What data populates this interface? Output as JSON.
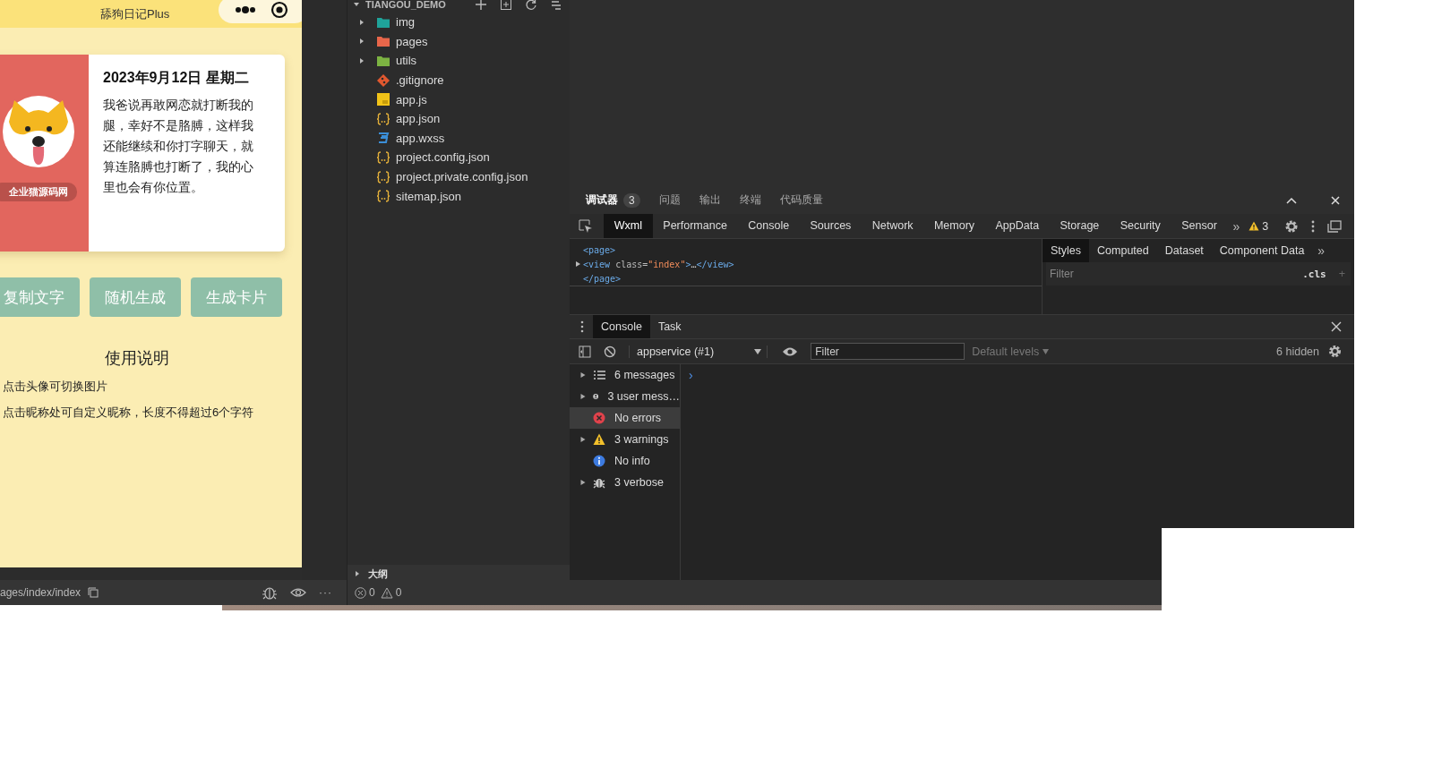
{
  "simulator": {
    "title": "舔狗日记Plus",
    "card": {
      "nickname": "企业猫源码网",
      "date": "2023年9月12日 星期二",
      "text": "我爸说再敢网恋就打断我的腿，幸好不是胳膊，这样我还能继续和你打字聊天，就算连胳膊也打断了，我的心里也会有你位置。"
    },
    "buttons": [
      "复制文字",
      "随机生成",
      "生成卡片"
    ],
    "help": {
      "title": "使用说明",
      "items": [
        "点击头像可切换图片",
        "点击昵称处可自定义昵称，长度不得超过6个字符"
      ]
    }
  },
  "explorer": {
    "title": "TIANGOU_DEMO",
    "files": [
      {
        "name": "img",
        "kind": "folder",
        "color": "#1fa39a",
        "expanded": false
      },
      {
        "name": "pages",
        "kind": "folder",
        "color": "#e8664a",
        "expanded": false
      },
      {
        "name": "utils",
        "kind": "folder",
        "color": "#7cb342",
        "expanded": false
      },
      {
        "name": ".gitignore",
        "kind": "git"
      },
      {
        "name": "app.js",
        "kind": "js"
      },
      {
        "name": "app.json",
        "kind": "json"
      },
      {
        "name": "app.wxss",
        "kind": "css"
      },
      {
        "name": "project.config.json",
        "kind": "json"
      },
      {
        "name": "project.private.config.json",
        "kind": "json"
      },
      {
        "name": "sitemap.json",
        "kind": "json"
      }
    ],
    "outline": {
      "label": "大纲",
      "expanded": false
    }
  },
  "devtools": {
    "tabs": [
      {
        "label": "调试器",
        "badge": "3",
        "selected": true
      },
      {
        "label": "问题",
        "selected": false
      },
      {
        "label": "输出",
        "selected": false
      },
      {
        "label": "终端",
        "selected": false
      },
      {
        "label": "代码质量",
        "selected": false
      }
    ],
    "panels": [
      {
        "label": "Wxml",
        "selected": true
      },
      {
        "label": "Performance",
        "selected": false
      },
      {
        "label": "Console",
        "selected": false
      },
      {
        "label": "Sources",
        "selected": false
      },
      {
        "label": "Network",
        "selected": false
      },
      {
        "label": "Memory",
        "selected": false
      },
      {
        "label": "AppData",
        "selected": false
      },
      {
        "label": "Storage",
        "selected": false
      },
      {
        "label": "Security",
        "selected": false
      },
      {
        "label": "Sensor",
        "selected": false
      }
    ],
    "more": "»",
    "warnings": "3",
    "wxml": [
      {
        "expandable": false,
        "parts": [
          {
            "kind": "tag",
            "text": "<page>"
          }
        ]
      },
      {
        "expandable": true,
        "parts": [
          {
            "kind": "tag",
            "text": "<view"
          },
          {
            "kind": "attr",
            "text": " class="
          },
          {
            "kind": "value",
            "text": "\"index\""
          },
          {
            "kind": "tag",
            "text": ">"
          },
          {
            "kind": "plain",
            "text": "…"
          },
          {
            "kind": "tag",
            "text": "</view>"
          }
        ]
      },
      {
        "expandable": false,
        "parts": [
          {
            "kind": "tag",
            "text": "</page>"
          }
        ]
      }
    ],
    "styles": {
      "tabs": [
        {
          "label": "Styles",
          "selected": true
        },
        {
          "label": "Computed",
          "selected": false
        },
        {
          "label": "Dataset",
          "selected": false
        },
        {
          "label": "Component Data",
          "selected": false
        }
      ],
      "more": "»",
      "filter_placeholder": "Filter",
      "cls": ".cls",
      "add": "+"
    },
    "drawer": {
      "tabs": [
        {
          "label": "Console",
          "selected": true
        },
        {
          "label": "Task",
          "selected": false
        }
      ],
      "context": "appservice (#1)",
      "filter_placeholder": "Filter",
      "levels": "Default levels",
      "hidden": "6 hidden",
      "sidebar": [
        {
          "label": "6 messages",
          "kind": "list",
          "expandable": true,
          "selected": false
        },
        {
          "label": "3 user mess…",
          "kind": "user",
          "expandable": true,
          "selected": false
        },
        {
          "label": "No errors",
          "kind": "error",
          "expandable": false,
          "selected": true
        },
        {
          "label": "3 warnings",
          "kind": "warning",
          "expandable": true,
          "selected": false
        },
        {
          "label": "No info",
          "kind": "info",
          "expandable": false,
          "selected": false
        },
        {
          "label": "3 verbose",
          "kind": "verbose",
          "expandable": true,
          "selected": false
        }
      ],
      "prompt": "›"
    }
  },
  "status_bar": {
    "path": "ages/index/index",
    "more": "···",
    "errors": "0",
    "warnings": "0"
  }
}
